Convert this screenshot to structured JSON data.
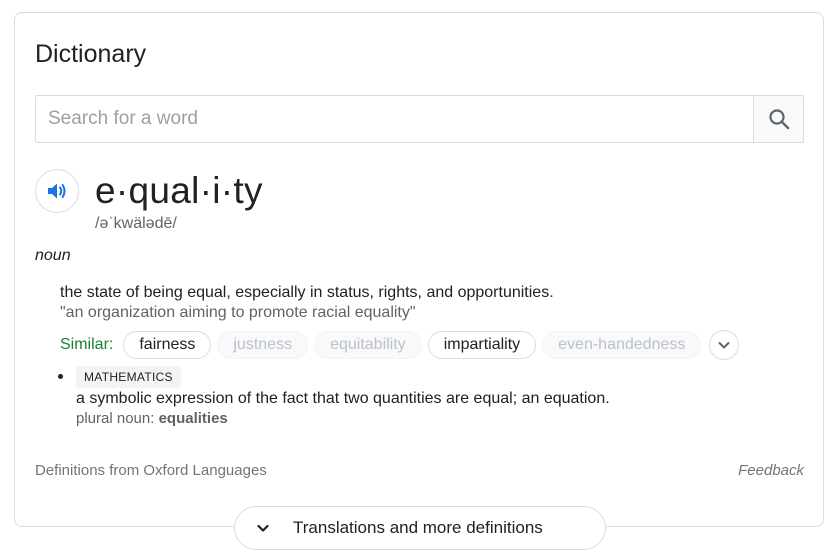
{
  "header": {
    "title": "Dictionary"
  },
  "search": {
    "placeholder": "Search for a word",
    "value": ""
  },
  "entry": {
    "word": "e·qual·i·ty",
    "phonetic": "/əˈkwälədē/",
    "part_of_speech": "noun",
    "senses": [
      {
        "definition": "the state of being equal, especially in status, rights, and opportunities.",
        "example": "\"an organization aiming to promote racial equality\"",
        "similar_label": "Similar:",
        "similar": [
          {
            "word": "fairness",
            "active": true
          },
          {
            "word": "justness",
            "active": false
          },
          {
            "word": "equitability",
            "active": false
          },
          {
            "word": "impartiality",
            "active": true
          },
          {
            "word": "even-handedness",
            "active": false
          }
        ]
      },
      {
        "domain": "MATHEMATICS",
        "definition": "a symbolic expression of the fact that two quantities are equal; an equation.",
        "plural_label": "plural noun:",
        "plural_value": "equalities"
      }
    ]
  },
  "footer": {
    "source": "Definitions from Oxford Languages",
    "feedback": "Feedback",
    "more_label": "Translations and more definitions"
  },
  "icons": {
    "search": "search-icon",
    "speaker": "speaker-icon",
    "expand": "chevron-down-icon",
    "more": "chevron-down-icon"
  },
  "colors": {
    "accent_blue": "#1a73e8",
    "similar_green": "#188038",
    "muted_text": "#5f6368"
  }
}
